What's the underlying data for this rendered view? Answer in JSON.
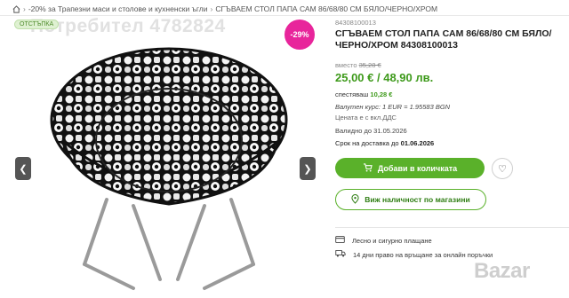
{
  "breadcrumb": {
    "home_icon": "home-icon",
    "items": [
      "-20% за Трапезни маси и столове и кухненски ъгли",
      "СГЪВАЕМ СТОЛ ПАПА САМ 86/68/80 СМ БЯЛО/ЧЕРНО/ХРОМ"
    ]
  },
  "watermark": "Потребител 4782824",
  "badge_green": "ОТСТЪПКА",
  "discount_badge": "-29%",
  "product": {
    "sku": "84308100013",
    "title": "СГЪВАЕМ СТОЛ ПАПА САМ 86/68/80 СМ БЯЛО/ЧЕРНО/ХРОМ 84308100013",
    "old_price_label": "вместо",
    "old_price": "35,28 €",
    "price": "25,00 €  / 48,90 лв.",
    "saving_label": "спестяваш",
    "saving_value": "10,28 €",
    "rate": "Валутен курс: 1 EUR = 1.95583 BGN",
    "vat": "Цената е с вкл.ДДС",
    "valid": "Валидно до 31.05.2026",
    "delivery_label": "Срок на доставка до",
    "delivery_date": "01.06.2026"
  },
  "buttons": {
    "add_to_cart": "Добави в количката",
    "availability": "Виж наличност по магазини"
  },
  "features": [
    "Лесно и сигурно плащане",
    "14 дни право на връщане за онлайн поръчки"
  ],
  "colors": {
    "accent_green": "#5ab12a",
    "price_green": "#3e9a1b",
    "discount_pink": "#e8259b"
  },
  "corner_watermark": "Bazar"
}
